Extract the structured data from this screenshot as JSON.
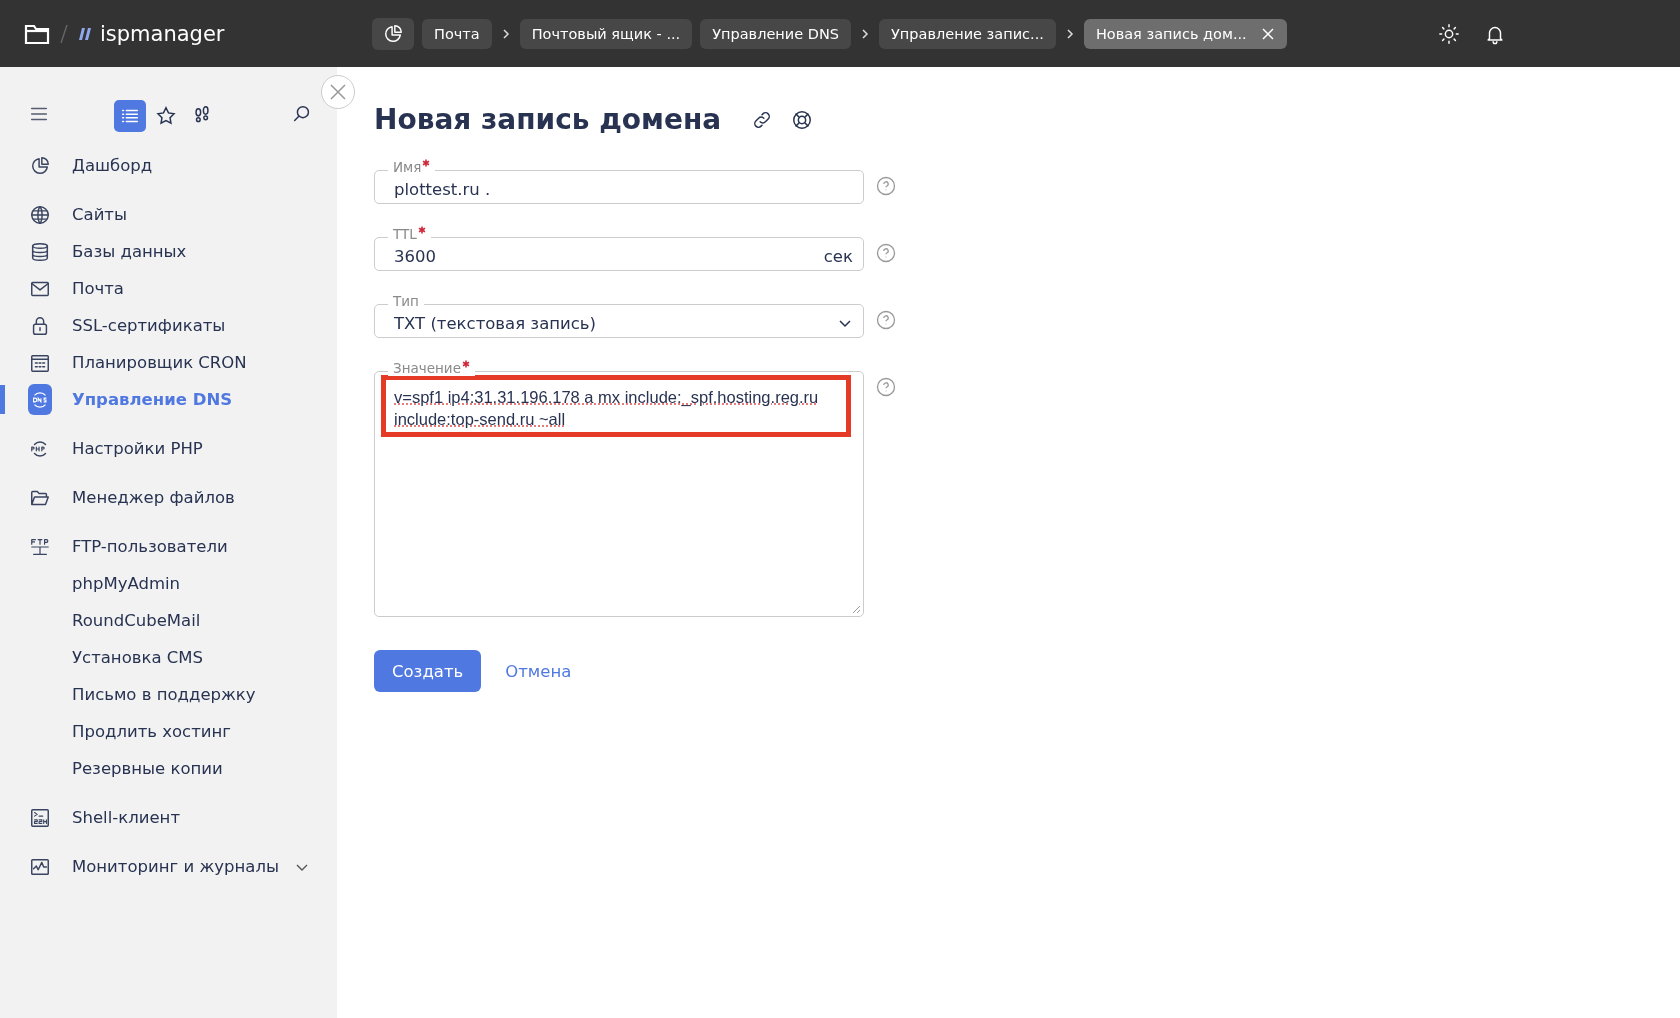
{
  "topbar": {
    "logo": "ispmanager",
    "breadcrumbs": [
      {
        "label": "Почта",
        "selected": false,
        "chevron_after": true
      },
      {
        "label": "Почтовый ящик - ...",
        "selected": false,
        "chevron_after": false
      },
      {
        "label": "Управление DNS",
        "selected": false,
        "chevron_after": true
      },
      {
        "label": "Управление запис...",
        "selected": false,
        "chevron_after": true
      },
      {
        "label": "Новая запись дом...",
        "selected": true,
        "chevron_after": false
      }
    ]
  },
  "sidebar": {
    "view_tabs": [
      {
        "kind": "list",
        "selected": true
      },
      {
        "kind": "star",
        "selected": false
      },
      {
        "kind": "steps",
        "selected": false
      }
    ],
    "sections": [
      [
        {
          "label": "Дашборд",
          "kind": "dashboard",
          "selected": false
        }
      ],
      [
        {
          "label": "Сайты",
          "kind": "globe",
          "selected": false
        },
        {
          "label": "Базы данных",
          "kind": "database",
          "selected": false
        },
        {
          "label": "Почта",
          "kind": "mail",
          "selected": false
        },
        {
          "label": "SSL-сертификаты",
          "kind": "lock",
          "selected": false
        },
        {
          "label": "Планировщик CRON",
          "kind": "calendar",
          "selected": false
        },
        {
          "label": "Управление DNS",
          "kind": "dns",
          "selected": true
        }
      ],
      [
        {
          "label": "Настройки PHP",
          "kind": "php",
          "selected": false
        }
      ],
      [
        {
          "label": "Менеджер файлов",
          "kind": "folder",
          "selected": false
        }
      ],
      [
        {
          "label": "FTP-пользователи",
          "kind": "ftp",
          "selected": false
        },
        {
          "label": "phpMyAdmin",
          "kind": "plain",
          "selected": false
        },
        {
          "label": "RoundCubeMail",
          "kind": "plain",
          "selected": false
        },
        {
          "label": "Установка CMS",
          "kind": "plain",
          "selected": false
        },
        {
          "label": "Письмо в поддержку",
          "kind": "plain",
          "selected": false
        },
        {
          "label": "Продлить хостинг",
          "kind": "plain",
          "selected": false
        },
        {
          "label": "Резервные копии",
          "kind": "plain",
          "selected": false
        }
      ],
      [
        {
          "label": "Shell-клиент",
          "kind": "ssh",
          "selected": false
        }
      ],
      [
        {
          "label": "Мониторинг и журналы",
          "kind": "monitor",
          "selected": false,
          "expanded": false
        }
      ]
    ]
  },
  "form": {
    "title": "Новая запись домена",
    "fields": [
      {
        "kind": "text",
        "label": "Имя",
        "required": true,
        "value": "plottest.ru ."
      },
      {
        "kind": "text",
        "label": "TTL",
        "required": true,
        "value": "3600",
        "suffix": "сек"
      },
      {
        "kind": "select",
        "label": "Тип",
        "required": false,
        "value": "TXT (текстовая запись)"
      },
      {
        "kind": "textarea",
        "label": "Значение",
        "required": true,
        "value": "v=spf1 ip4:31.31.196.178 a mx include:_spf.hosting.reg.ru include:top-send.ru ~all",
        "highlighted": true
      }
    ],
    "buttons": [
      {
        "kind": "primary",
        "label": "Создать"
      },
      {
        "kind": "link",
        "label": "Отмена"
      }
    ]
  }
}
